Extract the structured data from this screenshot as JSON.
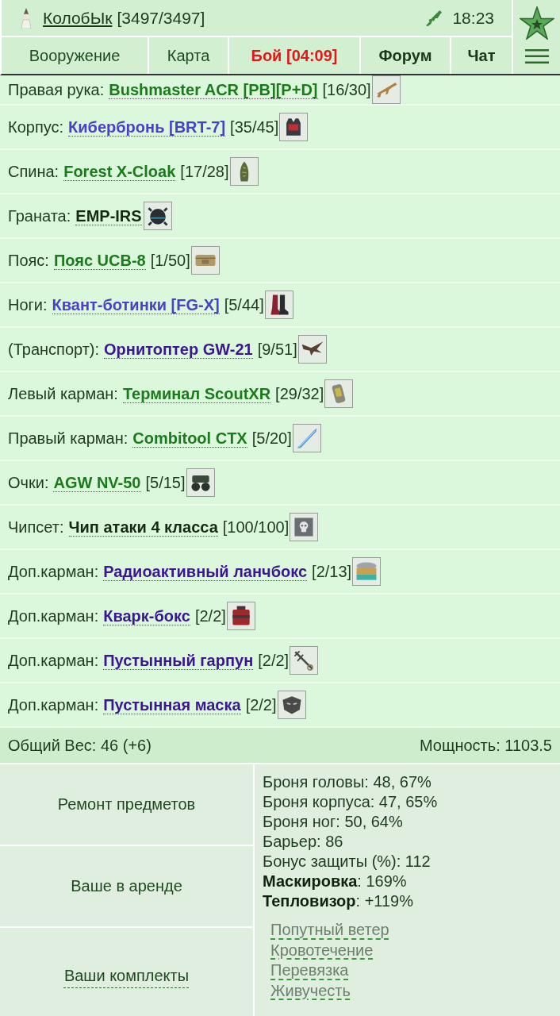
{
  "header": {
    "player_name": "КолобЫк",
    "health": "[3497/3497]",
    "time": "18:23"
  },
  "tabs": [
    {
      "label": "Вооружение",
      "kind": "plain"
    },
    {
      "label": "Карта",
      "kind": "plain"
    },
    {
      "label": "Бой [04:09]",
      "kind": "alert"
    },
    {
      "label": "Форум",
      "kind": "bold"
    },
    {
      "label": "Чат",
      "kind": "bold"
    }
  ],
  "items": [
    {
      "slot": "Правая рука:",
      "name": "Bushmaster ACR [PB][P+D]",
      "color": "#1b7a1b",
      "durability": "[16/30]"
    },
    {
      "slot": "Корпус:",
      "name": "Кибербронь [BRT-7]",
      "color": "#4b40c8",
      "durability": "[35/45]"
    },
    {
      "slot": "Спина:",
      "name": "Forest X-Cloak",
      "color": "#1b7a1b",
      "durability": "[17/28]"
    },
    {
      "slot": "Граната:",
      "name": "EMP-IRS",
      "color": "#142a14"
    },
    {
      "slot": "Пояс:",
      "name": "Пояс UCB-8",
      "color": "#1b7a1b",
      "durability": "[1/50]"
    },
    {
      "slot": "Ноги:",
      "name": "Квант-ботинки [FG-X]",
      "color": "#4b40c8",
      "durability": "[5/44]"
    },
    {
      "slot": "(Транспорт):",
      "name": "Орнитоптер GW-21",
      "color": "#3a1692",
      "durability": "[9/51]"
    },
    {
      "slot": "Левый карман:",
      "name": "Терминал ScoutXR",
      "color": "#1b7a1b",
      "durability": "[29/32]"
    },
    {
      "slot": "Правый карман:",
      "name": "Combitool CTX",
      "color": "#1b7a1b",
      "durability": "[5/20]"
    },
    {
      "slot": "Очки:",
      "name": "AGW NV-50",
      "color": "#1b7a1b",
      "durability": "[5/15]"
    },
    {
      "slot": "Чипсет:",
      "name": "Чип атаки 4 класса",
      "color": "#142a14",
      "durability": "[100/100]"
    },
    {
      "slot": "Доп.карман:",
      "name": "Радиоактивный ланчбокс",
      "color": "#3a1692",
      "durability": "[2/13]"
    },
    {
      "slot": "Доп.карман:",
      "name": "Кварк-бокс",
      "color": "#3a1692",
      "durability": "[2/2]"
    },
    {
      "slot": "Доп.карман:",
      "name": "Пустынный гарпун",
      "color": "#3a1692",
      "durability": "[2/2]"
    },
    {
      "slot": "Доп.карман:",
      "name": "Пустынная маска",
      "color": "#3a1692",
      "durability": "[2/2]"
    }
  ],
  "summary": {
    "weight": "Общий Вес: 46 (+6)",
    "power": "Мощность: 1103.5"
  },
  "actions": [
    {
      "label": "Ремонт предметов",
      "kind": "button"
    },
    {
      "label": "Ваше в аренде",
      "kind": "button"
    },
    {
      "label": "Ваши комплекты",
      "kind": "link"
    }
  ],
  "stats": [
    "Броня головы: 48, 67%",
    "Броня корпуса: 47, 65%",
    "Броня ног: 50, 64%",
    "Барьер: 86",
    "Бонус защиты (%): 112",
    "**Маскировка**: 169%",
    "**Тепловизор**: +119%"
  ],
  "effects": [
    "Попутный ветер",
    "Кровотечение",
    "Перевязка",
    "Живучесть"
  ]
}
